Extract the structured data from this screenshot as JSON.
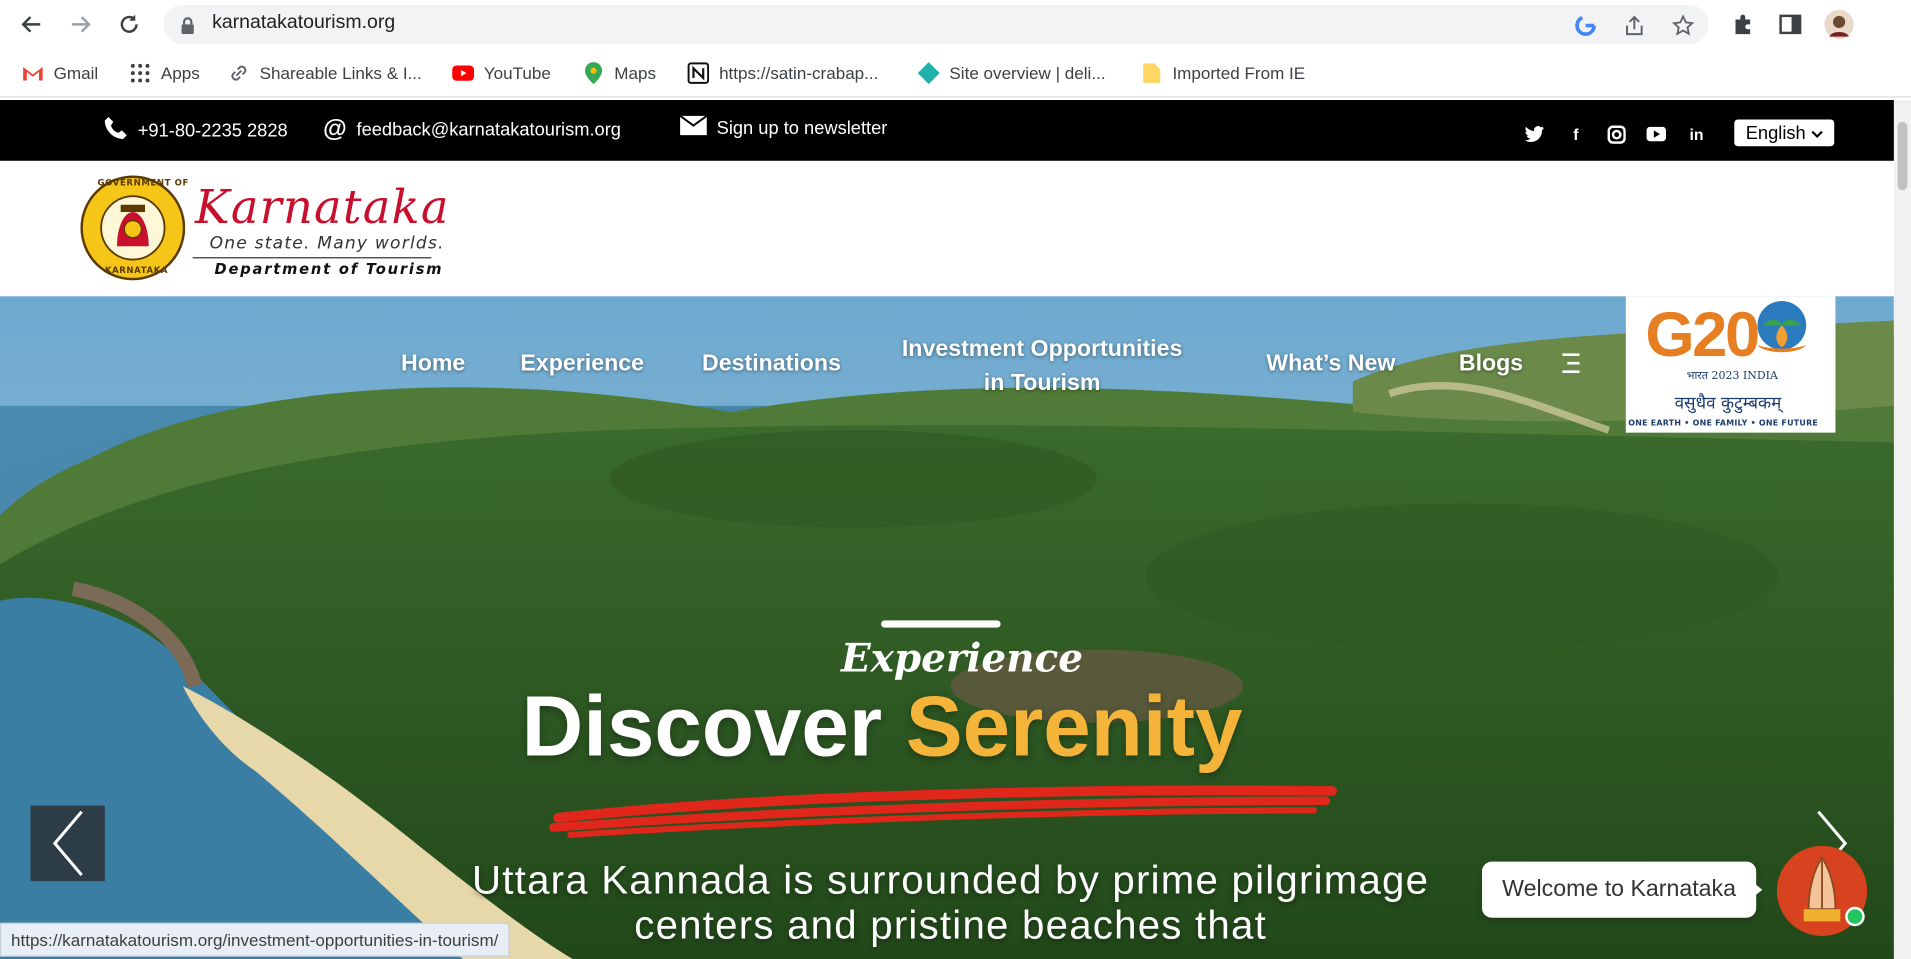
{
  "browser": {
    "url": "karnatakatourism.org",
    "status_url": "https://karnatakatourism.org/investment-opportunities-in-tourism/"
  },
  "bookmarks": [
    {
      "label": "Gmail",
      "icon": "gmail-icon"
    },
    {
      "label": "Apps",
      "icon": "apps-grid-icon"
    },
    {
      "label": "Shareable Links & I...",
      "icon": "link-icon"
    },
    {
      "label": "YouTube",
      "icon": "youtube-icon"
    },
    {
      "label": "Maps",
      "icon": "maps-pin-icon"
    },
    {
      "label": "https://satin-crabap...",
      "icon": "notion-icon"
    },
    {
      "label": "Site overview | deli...",
      "icon": "diamond-icon"
    },
    {
      "label": "Imported From IE",
      "icon": "folder-icon"
    }
  ],
  "topbar": {
    "phone": "+91-80-2235 2828",
    "email": "feedback@karnatakatourism.org",
    "newsletter": "Sign up to newsletter",
    "language": "English"
  },
  "logo": {
    "emblem_top": "GOVERNMENT OF",
    "emblem_bottom": "KARNATAKA",
    "brand": "Karnataka",
    "tagline": "One state. Many worlds.",
    "department": "Department of Tourism"
  },
  "nav": {
    "home": "Home",
    "experience": "Experience",
    "destinations": "Destinations",
    "investment_line1": "Investment Opportunities",
    "investment_line2": "in Tourism",
    "whats_new": "What’s New",
    "blogs": "Blogs"
  },
  "g20": {
    "logo_text": "G20",
    "year": "भारत 2023 INDIA",
    "motto_hindi": "वसुधैव कुटुम्बकम्",
    "motto_en": "ONE EARTH • ONE FAMILY • ONE FUTURE"
  },
  "hero": {
    "eyebrow": "Experience",
    "title_white": "Discover",
    "title_accent": "Serenity",
    "description": "Uttara Kannada is surrounded by prime pilgrimage centers and pristine beaches that"
  },
  "chat": {
    "welcome": "Welcome to Karnataka"
  },
  "colors": {
    "accent": "#f4b43a",
    "brand_red": "#c8102e",
    "topbar": "#000000",
    "underline": "#e1261c"
  }
}
